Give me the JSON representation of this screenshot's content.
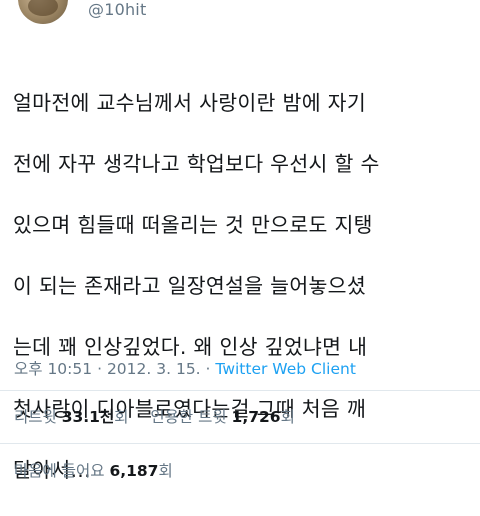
{
  "user": {
    "handle": "@10hit"
  },
  "tweet": {
    "lines": [
      "얼마전에 교수님께서 사랑이란 밤에 자기",
      "전에 자꾸 생각나고 학업보다 우선시 할 수",
      "있으며 힘들때 떠올리는 것 만으로도 지탱",
      "이 되는 존재라고 일장연설을 늘어놓으셨",
      "는데 꽤 인상깊었다. 왜 인상 깊었냐면 내",
      "첫사랑이 디아블로였다는걸 그때 처음 깨",
      "달아서..."
    ],
    "time": "오후 10:51",
    "separator": "·",
    "date": "2012. 3. 15.",
    "client": "Twitter Web Client"
  },
  "stats": {
    "retweet_label": "리트윗",
    "retweet_count": "33.1천",
    "retweet_unit": "회",
    "quote_label": "인용한 트윗",
    "quote_count": "1,726",
    "quote_unit": "회",
    "like_label": "마음에 들어요",
    "like_count": "6,187",
    "like_unit": "회"
  },
  "colors": {
    "text": "#14171a",
    "secondary": "#657786",
    "link": "#1da1f2",
    "divider": "#e1e8ed"
  }
}
